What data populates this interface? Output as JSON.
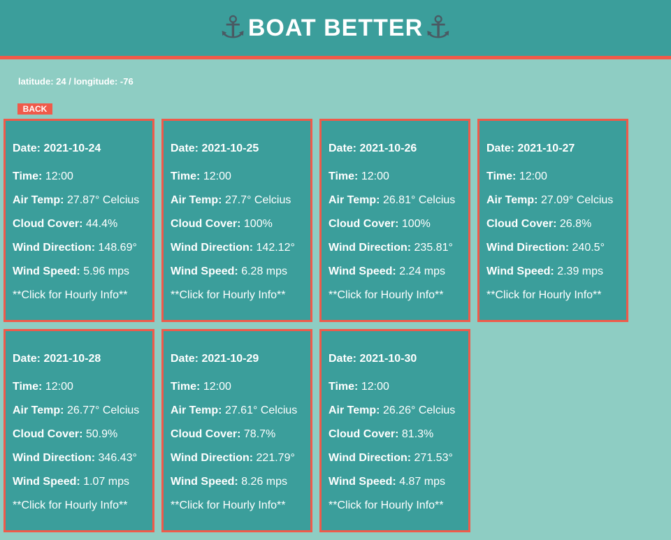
{
  "header": {
    "title": "BOAT BETTER",
    "anchor_glyph": "⚓",
    "colors": {
      "header_bg": "#3b9e9b",
      "accent": "#f05a4a",
      "page_bg": "#8ecdc3"
    }
  },
  "location": {
    "text": "latitude: 24 / longitude: -76"
  },
  "back_button": {
    "label": "BACK"
  },
  "labels": {
    "date": "Date:",
    "time": "Time:",
    "air_temp": "Air Temp:",
    "cloud_cover": "Cloud Cover:",
    "wind_direction": "Wind Direction:",
    "wind_speed": "Wind Speed:",
    "hint": "**Click for Hourly Info**"
  },
  "forecast": [
    {
      "date": "2021-10-24",
      "time": "12:00",
      "air_temp": "27.87° Celcius",
      "cloud_cover": "44.4%",
      "wind_direction": "148.69°",
      "wind_speed": "5.96 mps"
    },
    {
      "date": "2021-10-25",
      "time": "12:00",
      "air_temp": "27.7° Celcius",
      "cloud_cover": "100%",
      "wind_direction": "142.12°",
      "wind_speed": "6.28 mps"
    },
    {
      "date": "2021-10-26",
      "time": "12:00",
      "air_temp": "26.81° Celcius",
      "cloud_cover": "100%",
      "wind_direction": "235.81°",
      "wind_speed": "2.24 mps"
    },
    {
      "date": "2021-10-27",
      "time": "12:00",
      "air_temp": "27.09° Celcius",
      "cloud_cover": "26.8%",
      "wind_direction": "240.5°",
      "wind_speed": "2.39 mps"
    },
    {
      "date": "2021-10-28",
      "time": "12:00",
      "air_temp": "26.77° Celcius",
      "cloud_cover": "50.9%",
      "wind_direction": "346.43°",
      "wind_speed": "1.07 mps"
    },
    {
      "date": "2021-10-29",
      "time": "12:00",
      "air_temp": "27.61° Celcius",
      "cloud_cover": "78.7%",
      "wind_direction": "221.79°",
      "wind_speed": "8.26 mps"
    },
    {
      "date": "2021-10-30",
      "time": "12:00",
      "air_temp": "26.26° Celcius",
      "cloud_cover": "81.3%",
      "wind_direction": "271.53°",
      "wind_speed": "4.87 mps"
    }
  ]
}
